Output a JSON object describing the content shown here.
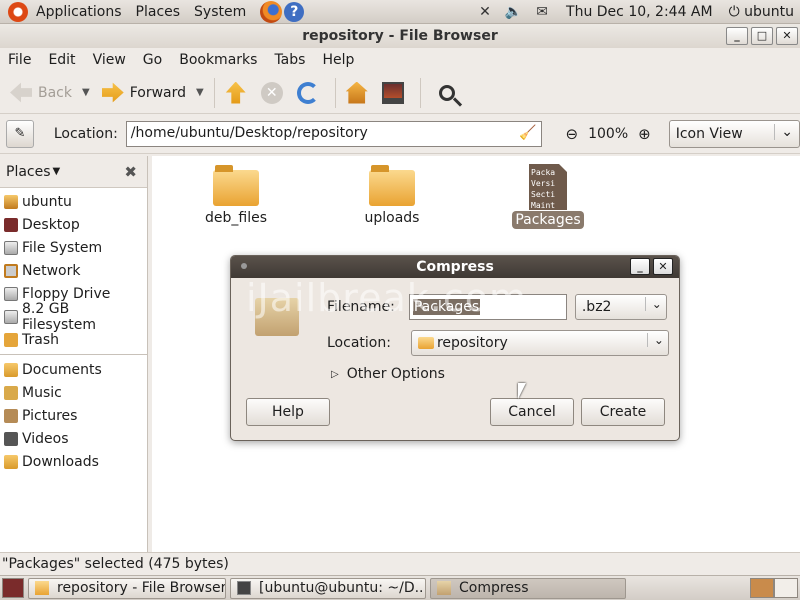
{
  "top_panel": {
    "menus": [
      "Applications",
      "Places",
      "System"
    ],
    "clock": "Thu Dec 10,  2:44 AM",
    "user": "ubuntu"
  },
  "window": {
    "title": "repository - File Browser",
    "controls": [
      "_",
      "□",
      "✕"
    ]
  },
  "menubar": [
    "File",
    "Edit",
    "View",
    "Go",
    "Bookmarks",
    "Tabs",
    "Help"
  ],
  "toolbar": {
    "back": "Back",
    "forward": "Forward"
  },
  "location": {
    "label": "Location:",
    "path": "/home/ubuntu/Desktop/repository",
    "zoom": "100%",
    "view_mode": "Icon View"
  },
  "sidebar": {
    "header": "Places",
    "devices": [
      "ubuntu",
      "Desktop",
      "File System",
      "Network",
      "Floppy Drive",
      "8.2 GB Filesystem",
      "Trash"
    ],
    "bookmarks": [
      "Documents",
      "Music",
      "Pictures",
      "Videos",
      "Downloads"
    ]
  },
  "files": [
    {
      "name": "deb_files",
      "type": "folder"
    },
    {
      "name": "uploads",
      "type": "folder"
    },
    {
      "name": "Packages",
      "type": "text",
      "preview": [
        "Packa",
        "Versi",
        "Secti",
        "Maint"
      ],
      "selected": true
    }
  ],
  "dialog": {
    "title": "Compress",
    "filename_label": "Filename:",
    "filename_value": "Packages",
    "extension": ".bz2",
    "location_label": "Location:",
    "location_value": "repository",
    "other_options": "Other Options",
    "help": "Help",
    "cancel": "Cancel",
    "create": "Create"
  },
  "watermark": "iJailbreak.com",
  "status": "\"Packages\" selected (475 bytes)",
  "taskbar": [
    {
      "label": "repository - File Browser",
      "active": false
    },
    {
      "label": "[ubuntu@ubuntu: ~/D...",
      "active": false
    },
    {
      "label": "Compress",
      "active": true
    }
  ]
}
